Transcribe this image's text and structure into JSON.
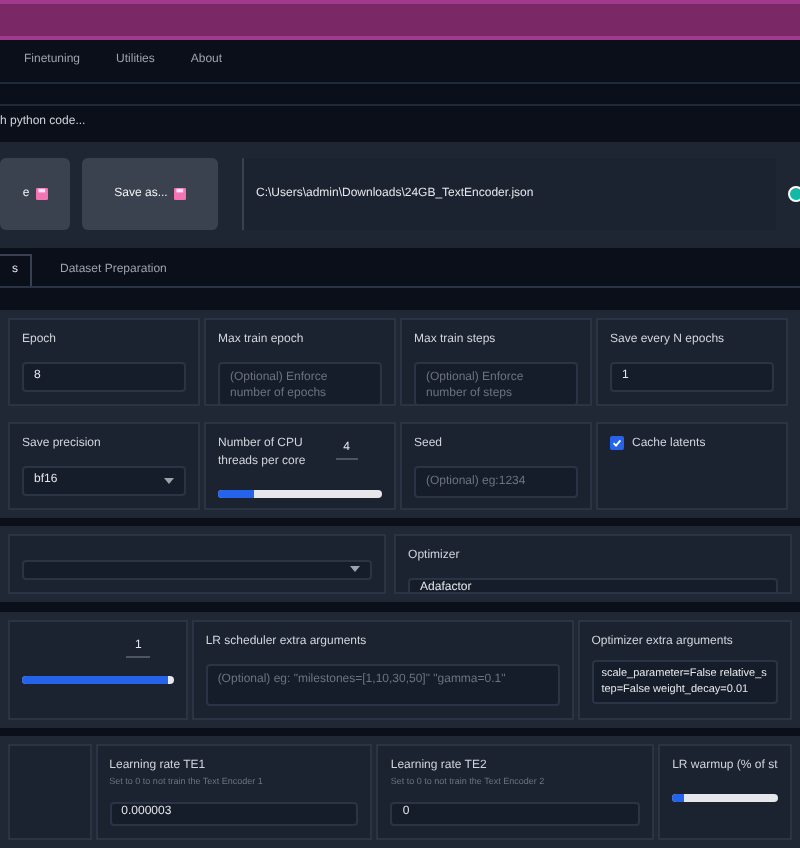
{
  "nav_tabs": [
    {
      "label": "Finetuning"
    },
    {
      "label": "Utilities"
    },
    {
      "label": "About"
    }
  ],
  "command_hint": "h python code...",
  "config": {
    "buttons": [
      {
        "label": "e"
      },
      {
        "label": "Save as..."
      }
    ],
    "path": "C:\\Users\\admin\\Downloads\\24GB_TextEncoder.json"
  },
  "sub_tabs": [
    {
      "label": "s",
      "selected": true
    },
    {
      "label": "Dataset Preparation",
      "selected": false
    }
  ],
  "row_1": [
    {
      "kind": "input",
      "label": "Epoch",
      "value": "8"
    },
    {
      "kind": "textarea",
      "label": "Max train epoch",
      "placeholder": "(Optional) Enforce number of epochs"
    },
    {
      "kind": "textarea",
      "label": "Max train steps",
      "placeholder": "(Optional) Enforce number of steps"
    },
    {
      "kind": "input",
      "label": "Save every N epochs",
      "value": "1"
    }
  ],
  "row_2": [
    {
      "kind": "dropdown",
      "label": "Save precision",
      "value": "bf16"
    },
    {
      "kind": "slider",
      "label": "Number of CPU threads per core",
      "value": "4",
      "level": 0.22
    },
    {
      "kind": "textarea",
      "label": "Seed",
      "placeholder": "(Optional) eg:1234"
    },
    {
      "kind": "checkbox",
      "label": "Cache latents",
      "checked": true
    }
  ],
  "row_3": [
    {
      "kind": "dropdown"
    },
    {
      "kind": "input",
      "label": "Optimizer",
      "value": "Adafactor"
    }
  ],
  "row_4": [
    {
      "kind": "slider",
      "value": "1",
      "level": 0.96
    },
    {
      "kind": "textarea",
      "label": "LR scheduler extra arguments",
      "placeholder": "(Optional) eg: \"milestones=[1,10,30,50]\" \"gamma=0.1\""
    },
    {
      "kind": "textarea",
      "label": "Optimizer extra arguments",
      "value": "scale_parameter=False relative_step=False weight_decay=0.01"
    }
  ],
  "row_5": [
    {
      "kind": "empty"
    },
    {
      "kind": "input",
      "label": "Learning rate TE1",
      "info": "Set to 0 to not train the Text Encoder 1",
      "value": "0.000003"
    },
    {
      "kind": "input",
      "label": "Learning rate TE2",
      "info": "Set to 0 to not train the Text Encoder 2",
      "value": "0"
    },
    {
      "kind": "slider",
      "label": "LR warmup (% of st",
      "level": 0.12
    }
  ]
}
